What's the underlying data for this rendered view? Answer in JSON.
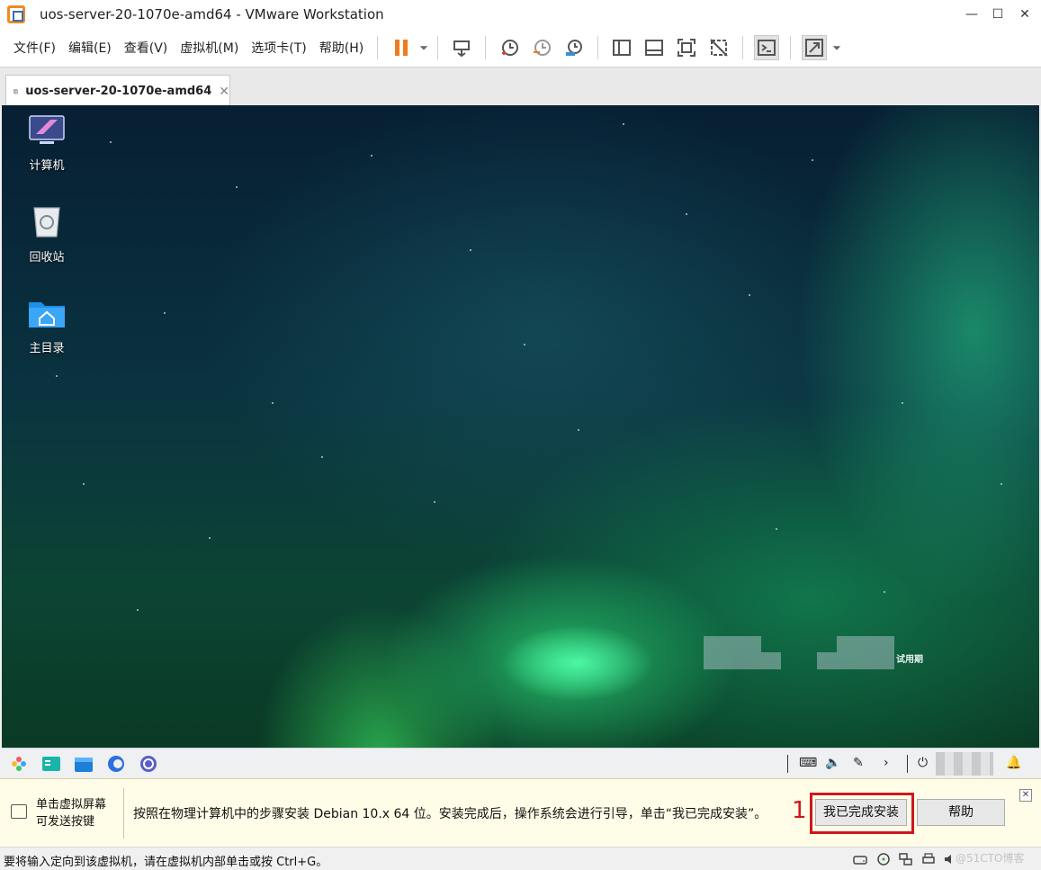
{
  "window": {
    "title": "uos-server-20-1070e-amd64 - VMware Workstation",
    "minimize": "—",
    "maximize": "☐",
    "close": "✕"
  },
  "menu": {
    "items": [
      "文件(F)",
      "编辑(E)",
      "查看(V)",
      "虚拟机(M)",
      "选项卡(T)",
      "帮助(H)"
    ]
  },
  "toolbar": {
    "icons": [
      "pause-icon",
      "dropdown-icon",
      "send-ctrl-alt-del-icon",
      "snapshot-icon",
      "revert-snapshot-icon",
      "snapshot-manager-icon",
      "library-icon",
      "thumbnail-icon",
      "full-screen-icon",
      "unity-icon",
      "console-icon",
      "stretch-icon"
    ],
    "accent": "#f07a1e"
  },
  "tab": {
    "label": "uos-server-20-1070e-amd64",
    "close": "✕"
  },
  "desktop": {
    "icons": [
      {
        "label": "计算机",
        "icon": "computer-icon"
      },
      {
        "label": "回收站",
        "icon": "trash-icon"
      },
      {
        "label": "主目录",
        "icon": "home-folder-icon"
      }
    ],
    "trial_label": "试用期"
  },
  "hint": {
    "left_line1": "单击虚拟屏幕",
    "left_line2": "可发送按键",
    "message": "按照在物理计算机中的步骤安装 Debian 10.x 64 位。安装完成后，操作系统会进行引导，单击“我已完成安装”。",
    "annotation": "1",
    "done_button": "我已完成安装",
    "help_button": "帮助",
    "close": "✕",
    "highlight_color": "#d0161c"
  },
  "status": {
    "text": "要将输入定向到该虚拟机，请在虚拟机内部单击或按 Ctrl+G。",
    "watermark": "@51CTO博客"
  }
}
